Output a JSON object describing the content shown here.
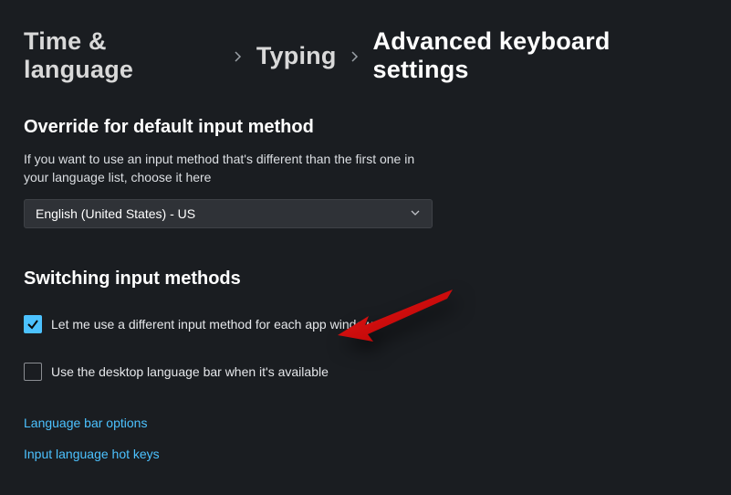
{
  "breadcrumb": {
    "item1": "Time & language",
    "item2": "Typing",
    "current": "Advanced keyboard settings"
  },
  "section1": {
    "title": "Override for default input method",
    "description": "If you want to use an input method that's different than the first one in your language list, choose it here",
    "dropdown_value": "English (United States) - US"
  },
  "section2": {
    "title": "Switching input methods",
    "checkbox1_label": "Let me use a different input method for each app window",
    "checkbox2_label": "Use the desktop language bar when it's available"
  },
  "links": {
    "language_bar": "Language bar options",
    "hotkeys": "Input language hot keys"
  }
}
